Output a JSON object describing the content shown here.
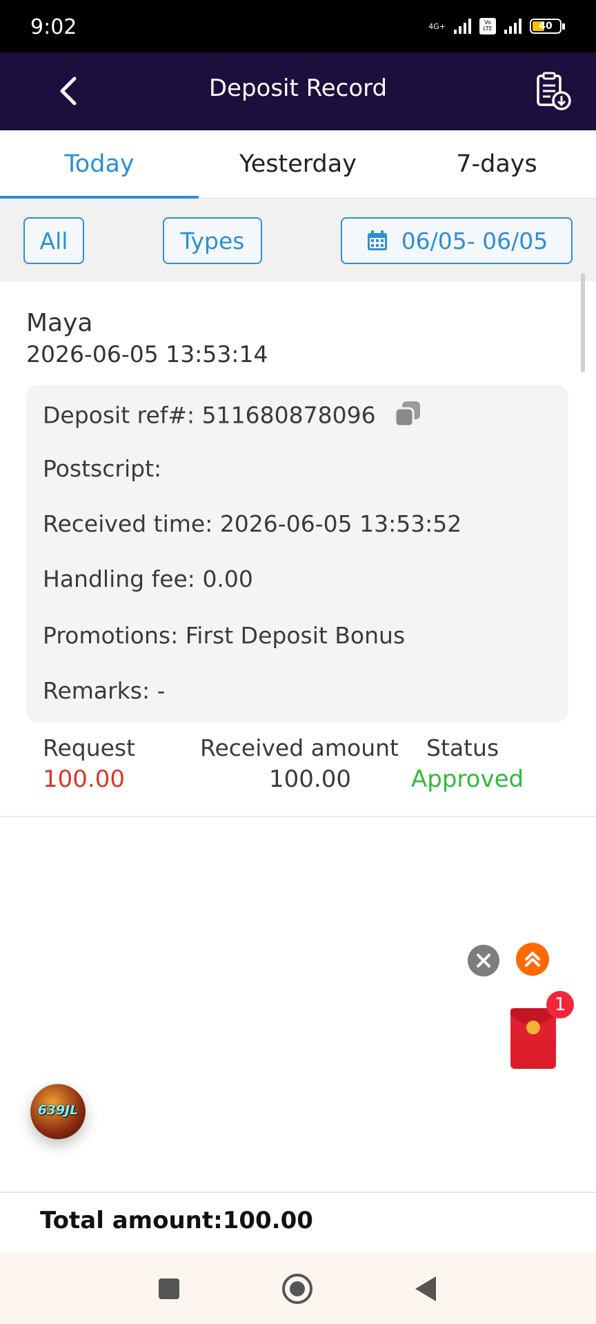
{
  "status_bar": {
    "time": "9:02",
    "network": "4G+",
    "volte": "Vo LTE",
    "battery": "40"
  },
  "header": {
    "title": "Deposit Record"
  },
  "tabs": [
    {
      "label": "Today",
      "active": true
    },
    {
      "label": "Yesterday",
      "active": false
    },
    {
      "label": "7-days",
      "active": false
    }
  ],
  "filters": {
    "all_label": "All",
    "types_label": "Types",
    "date_range": "06/05- 06/05"
  },
  "record": {
    "channel": "Maya",
    "time": "2026-06-05 13:53:14",
    "details": {
      "deposit_ref_label": "Deposit ref#:",
      "deposit_ref_value": "511680878096",
      "postscript_label": "Postscript:",
      "postscript_value": "",
      "received_time_label": "Received time:",
      "received_time_value": "2026-06-05 13:53:52",
      "handling_fee_label": "Handling fee:",
      "handling_fee_value": "0.00",
      "promotions_label": "Promotions:",
      "promotions_value": "First Deposit Bonus",
      "remarks_label": "Remarks:",
      "remarks_value": "-"
    },
    "request_label": "Request",
    "request_value": "100.00",
    "received_amount_label": "Received amount",
    "received_amount_value": "100.00",
    "status_label": "Status",
    "status_value": "Approved"
  },
  "floating": {
    "redpacket_badge": "1",
    "logo_text": "639JL"
  },
  "total": {
    "label": "Total amount:100.00"
  },
  "colors": {
    "accent": "#2b8fd6",
    "header_bg": "#1c0f3d",
    "request_red": "#e0352b",
    "approved_green": "#2dbb3a",
    "float_orange": "#ff6a00",
    "badge_red": "#f2263a"
  }
}
